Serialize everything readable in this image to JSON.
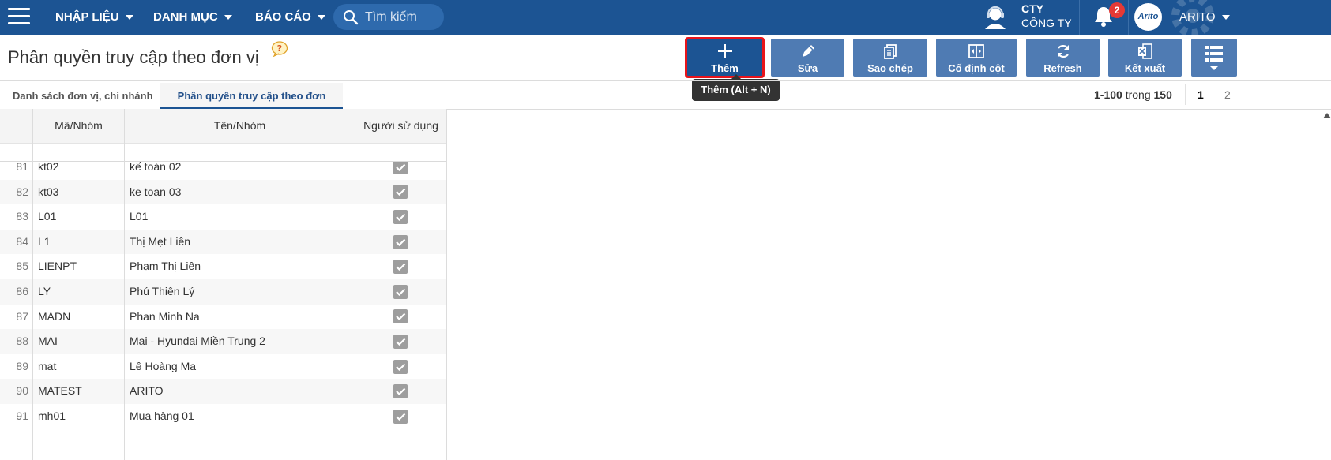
{
  "nav": {
    "menus": [
      {
        "label": "NHẬP LIỆU"
      },
      {
        "label": "DANH MỤC"
      },
      {
        "label": "BÁO CÁO"
      }
    ],
    "search_placeholder": "Tìm kiếm",
    "company_line1": "CTY",
    "company_line2": "CÔNG TY",
    "notification_count": "2",
    "avatar_text": "Arito",
    "username": "ARITO"
  },
  "page": {
    "title": "Phân quyền truy cập theo đơn vị"
  },
  "toolbar": {
    "add_label": "Thêm",
    "edit_label": "Sửa",
    "copy_label": "Sao chép",
    "freeze_label": "Cố định cột",
    "refresh_label": "Refresh",
    "export_label": "Kết xuất",
    "add_tooltip": "Thêm (Alt + N)"
  },
  "tabs": [
    {
      "label": "Danh sách đơn vị, chi nhánh"
    },
    {
      "label": "Phân quyền truy cập theo đơn vị"
    }
  ],
  "pager": {
    "range": "1-100",
    "of": "trong",
    "total": "150",
    "page1": "1",
    "page2": "2"
  },
  "table": {
    "columns": [
      "Mã/Nhóm",
      "Tên/Nhóm",
      "Người sử dụng"
    ],
    "rows": [
      {
        "num": "81",
        "code": "kt02",
        "name": "kế toán 02",
        "user": true
      },
      {
        "num": "82",
        "code": "kt03",
        "name": "ke toan 03",
        "user": true
      },
      {
        "num": "83",
        "code": "L01",
        "name": "L01",
        "user": true
      },
      {
        "num": "84",
        "code": "L1",
        "name": "Thị Mẹt Liên",
        "user": true
      },
      {
        "num": "85",
        "code": "LIENPT",
        "name": "Phạm Thị Liên",
        "user": true
      },
      {
        "num": "86",
        "code": "LY",
        "name": "Phú Thiên Lý",
        "user": true
      },
      {
        "num": "87",
        "code": "MADN",
        "name": "Phan Minh Na",
        "user": true
      },
      {
        "num": "88",
        "code": "MAI",
        "name": "Mai - Hyundai Miền Trung 2",
        "user": true
      },
      {
        "num": "89",
        "code": "mat",
        "name": "Lê Hoàng Ma",
        "user": true
      },
      {
        "num": "90",
        "code": "MATEST",
        "name": "ARITO",
        "user": true
      },
      {
        "num": "91",
        "code": "mh01",
        "name": "Mua hàng 01",
        "user": true
      }
    ]
  },
  "colors": {
    "nav_bg": "#1c5493",
    "button_bg": "#4f7bb3",
    "highlight": "#e8141a",
    "badge": "#e53935"
  }
}
